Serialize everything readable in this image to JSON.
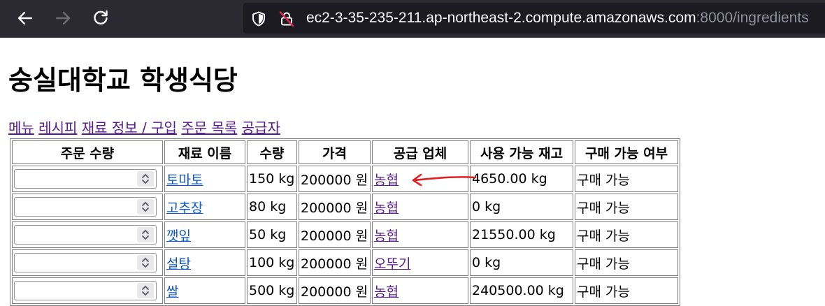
{
  "browser": {
    "url_host": "ec2-3-35-235-211.ap-northeast-2.compute.amazonaws.com",
    "url_rest": ":8000/ingredients"
  },
  "page": {
    "title": "숭실대학교 학생식당"
  },
  "nav": {
    "links": [
      "메뉴",
      "레시피",
      "재료 정보 / 구입",
      "주문 목록",
      "공급자"
    ]
  },
  "table": {
    "headers": [
      "주문 수량",
      "재료 이름",
      "수량",
      "가격",
      "공급 업체",
      "사용 가능 재고",
      "구매 가능 여부"
    ],
    "rows": [
      {
        "order_qty": "",
        "name": "토마토",
        "qty": "150 kg",
        "price": "200000 원",
        "supplier": "농협",
        "stock": "4650.00 kg",
        "availability": "구매 가능"
      },
      {
        "order_qty": "",
        "name": "고추장",
        "qty": "80 kg",
        "price": "200000 원",
        "supplier": "농협",
        "stock": "0 kg",
        "availability": "구매 가능"
      },
      {
        "order_qty": "",
        "name": "깻잎",
        "qty": "50 kg",
        "price": "200000 원",
        "supplier": "농협",
        "stock": "21550.00 kg",
        "availability": "구매 가능"
      },
      {
        "order_qty": "",
        "name": "설탕",
        "qty": "100 kg",
        "price": "200000 원",
        "supplier": "오뚜기",
        "stock": "0 kg",
        "availability": "구매 가능"
      },
      {
        "order_qty": "",
        "name": "쌀",
        "qty": "500 kg",
        "price": "200000 원",
        "supplier": "농협",
        "stock": "240500.00 kg",
        "availability": "구매 가능"
      }
    ]
  },
  "colors": {
    "chrome_bg": "#2b2a33",
    "urlbar_bg": "#1c1b22",
    "visited_link": "#551a8b",
    "link": "#0b56c9",
    "annotation_arrow": "#e02020"
  },
  "icons": [
    "back-icon",
    "forward-icon",
    "reload-icon",
    "shield-icon",
    "insecure-lock-icon",
    "spinner-arrows-icon",
    "red-arrow-annotation"
  ]
}
